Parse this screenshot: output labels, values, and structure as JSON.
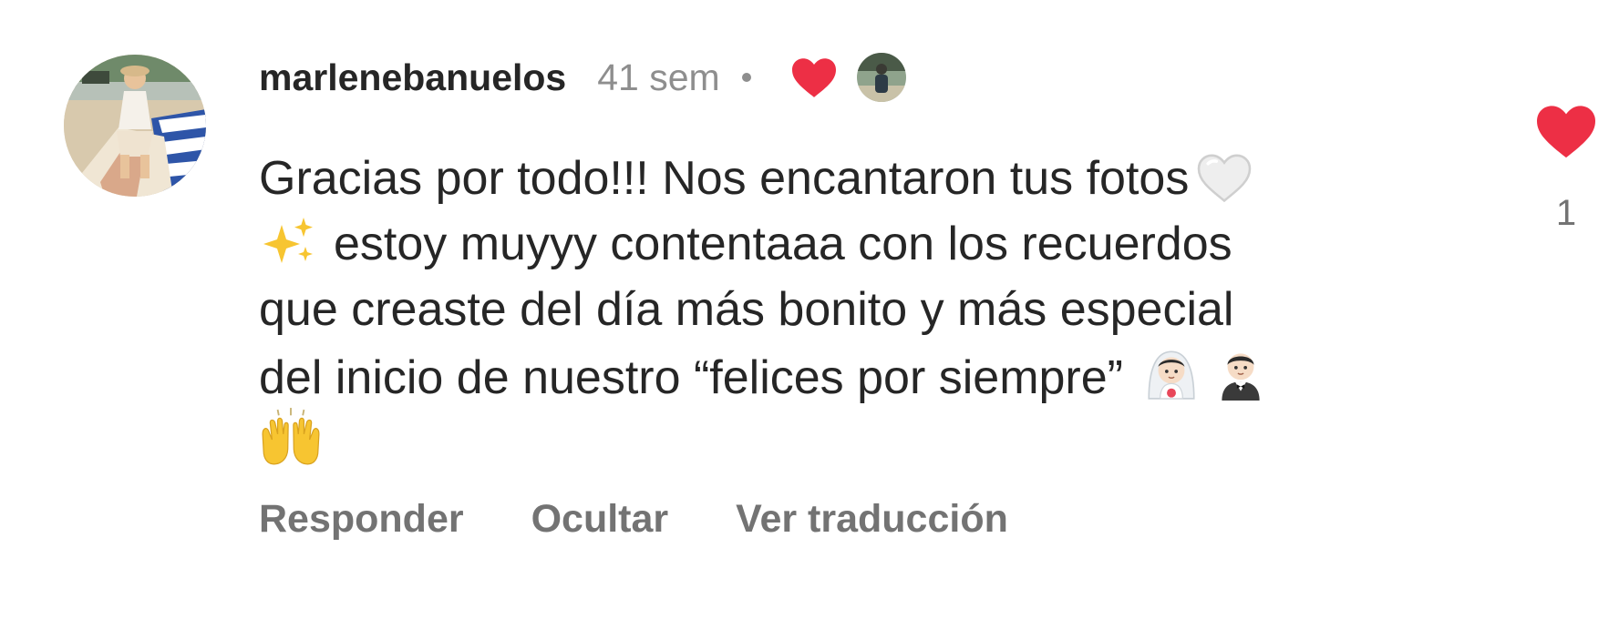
{
  "comment": {
    "username": "marlenebanuelos",
    "time": "41 sem",
    "author_liked_icon": "heart-icon",
    "text_lines": [
      "Gracias por todo!!! Nos encantaron tus fotos",
      "estoy muyyy contentaaa con los recuerdos",
      "que creaste del día más bonito y más especial",
      "del inicio de nuestro “felices por siempre”"
    ],
    "emojis": [
      "white-heart-icon",
      "sparkles-icon",
      "bride-icon",
      "groom-icon",
      "raised-hands-icon"
    ],
    "actions": {
      "reply": "Responder",
      "hide": "Ocultar",
      "translate": "Ver traducción"
    },
    "like_count": "1"
  },
  "colors": {
    "heart": "#ed2f45",
    "text": "#262626",
    "muted": "#8e8e8e",
    "action": "#737373"
  }
}
